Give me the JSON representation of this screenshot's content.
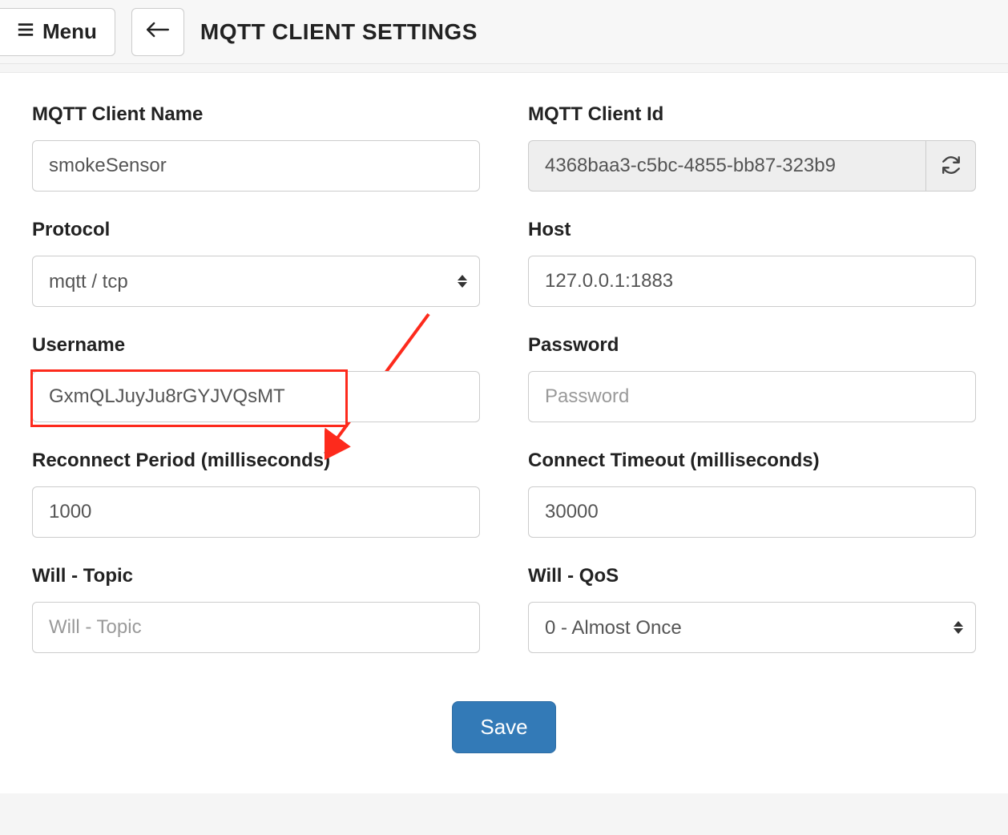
{
  "header": {
    "menu_label": "Menu",
    "page_title": "MQTT CLIENT SETTINGS"
  },
  "form": {
    "client_name": {
      "label": "MQTT Client Name",
      "value": "smokeSensor"
    },
    "client_id": {
      "label": "MQTT Client Id",
      "value": "4368baa3-c5bc-4855-bb87-323b9"
    },
    "protocol": {
      "label": "Protocol",
      "value": "mqtt / tcp"
    },
    "host": {
      "label": "Host",
      "value": "127.0.0.1:1883"
    },
    "username": {
      "label": "Username",
      "value": "GxmQLJuyJu8rGYJVQsMT"
    },
    "password": {
      "label": "Password",
      "value": "",
      "placeholder": "Password"
    },
    "reconnect": {
      "label": "Reconnect Period (milliseconds)",
      "value": "1000"
    },
    "timeout": {
      "label": "Connect Timeout (milliseconds)",
      "value": "30000"
    },
    "will_topic": {
      "label": "Will - Topic",
      "value": "",
      "placeholder": "Will - Topic"
    },
    "will_qos": {
      "label": "Will - QoS",
      "value": "0 - Almost Once"
    }
  },
  "actions": {
    "save_label": "Save"
  },
  "annotation": {
    "arrow_target": "username-field",
    "highlight_target": "username-field",
    "color": "#fd2a1c"
  }
}
